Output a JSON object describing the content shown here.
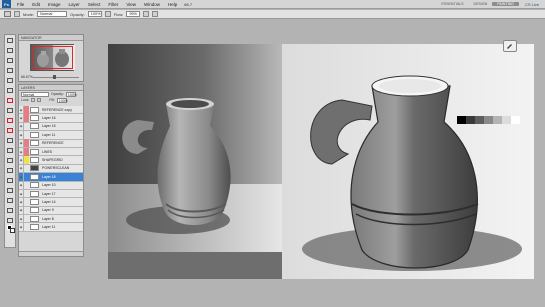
{
  "app": {
    "logo_text": "Ps",
    "menu": [
      "File",
      "Edit",
      "Image",
      "Layer",
      "Select",
      "Filter",
      "View",
      "Window",
      "Help"
    ],
    "zoom": "66.7",
    "workspaces": [
      "ESSENTIALS",
      "DESIGN",
      "PAINTING"
    ],
    "active_workspace": "PAINTING",
    "cs_live": "CS Live"
  },
  "options": {
    "mode_label": "Mode:",
    "mode_value": "Normal",
    "opacity_label": "Opacity:",
    "opacity_value": "100%",
    "flow_label": "Flow:",
    "flow_value": "95%"
  },
  "navigator": {
    "tab": "NAVIGATOR",
    "zoom": "66.67%"
  },
  "layers": {
    "tab": "LAYERS",
    "blend": "Normal",
    "opacity_label": "Opacity:",
    "opacity_value": "100%",
    "lock_label": "Lock:",
    "fill_label": "Fill:",
    "fill_value": "100%",
    "items": [
      {
        "name": "REFERENCE copy",
        "tag": "#e57e84"
      },
      {
        "name": "Layer 16",
        "tag": "#e57e84"
      },
      {
        "name": "Layer 15",
        "tag": ""
      },
      {
        "name": "Layer 11",
        "tag": ""
      },
      {
        "name": "REFERENCE",
        "tag": "#e57e84"
      },
      {
        "name": "LINES",
        "tag": "#e57e84"
      },
      {
        "name": "SHAPEGRID",
        "tag": "#f0e24a"
      },
      {
        "name": "POWERSCLEAN",
        "tag": ""
      },
      {
        "name": "Layer 18",
        "tag": ""
      },
      {
        "name": "Layer 10",
        "tag": ""
      },
      {
        "name": "Layer 17",
        "tag": ""
      },
      {
        "name": "Layer 14",
        "tag": ""
      },
      {
        "name": "Layer 9",
        "tag": ""
      },
      {
        "name": "Layer 8",
        "tag": ""
      },
      {
        "name": "Layer 11",
        "tag": ""
      }
    ],
    "selected_index": 8
  },
  "palette": [
    "#000000",
    "#3a3a3a",
    "#5f5f5f",
    "#8a8a8a",
    "#b4b4b4",
    "#dcdcdc",
    "#ffffff"
  ]
}
